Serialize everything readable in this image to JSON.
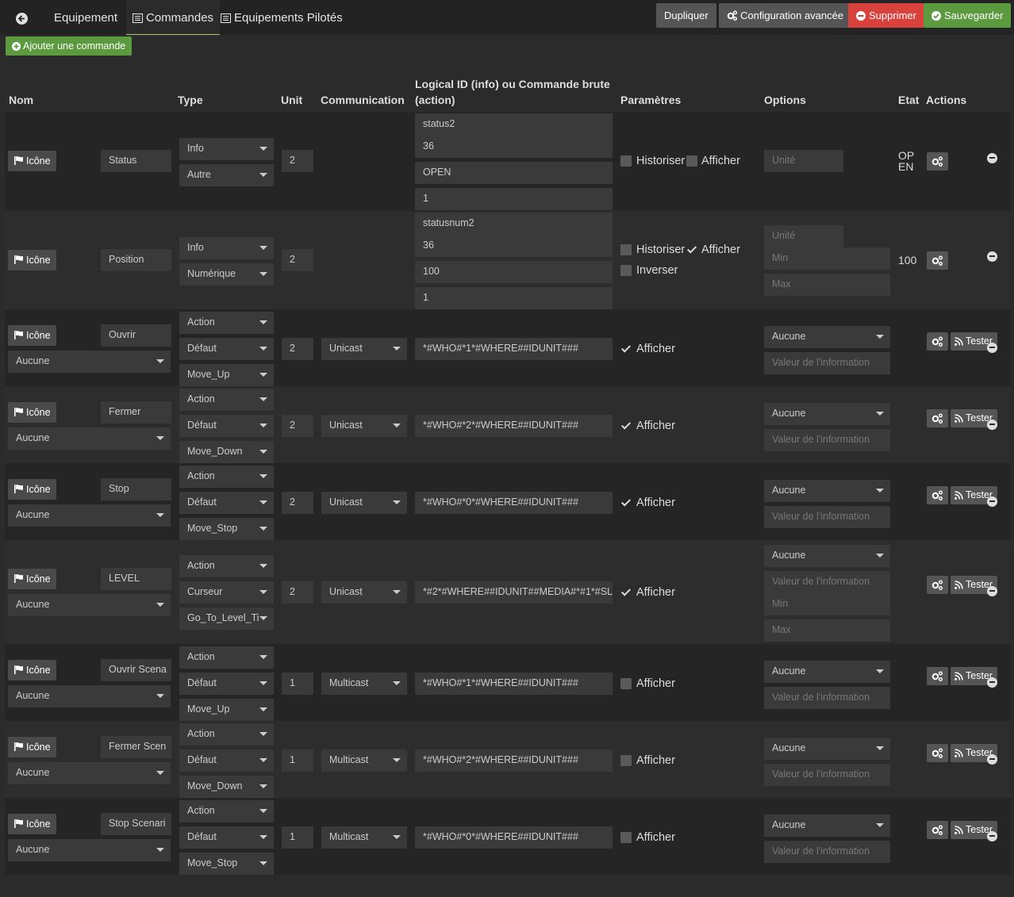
{
  "tabs": {
    "equipement": "Equipement",
    "commandes": "Commandes",
    "pilotes": "Equipements Pilotés"
  },
  "toolbar": {
    "dupliquer": "Dupliquer",
    "config": "Configuration avancée",
    "supprimer": "Supprimer",
    "sauvegarder": "Sauvegarder"
  },
  "add_command": "Ajouter une commande",
  "headers": {
    "nom": "Nom",
    "type": "Type",
    "unit": "Unit",
    "communication": "Communication",
    "logical_l1": "Logical ID (info) ou Commande brute",
    "logical_l2": "(action)",
    "parametres": "Paramètres",
    "options": "Options",
    "etat": "Etat",
    "actions": "Actions"
  },
  "labels": {
    "icone": "Icône",
    "historiser": "Historiser",
    "afficher": "Afficher",
    "inverser": "Inverser",
    "tester": "Tester"
  },
  "info_rows": [
    {
      "name": "Status",
      "type": "Info",
      "subtype": "Autre",
      "unit": "2",
      "logical": [
        "status2",
        "36",
        "OPEN",
        "1"
      ],
      "historiser": false,
      "afficher": false,
      "options": [
        "Unité"
      ],
      "state": [
        "OP",
        "EN"
      ]
    },
    {
      "name": "Position",
      "type": "Info",
      "subtype": "Numérique",
      "unit": "2",
      "logical": [
        "statusnum2",
        "36",
        "100",
        "1"
      ],
      "historiser": false,
      "afficher": true,
      "inverser": false,
      "options": [
        "Unité",
        "Min",
        "Max"
      ],
      "state": [
        "100"
      ]
    }
  ],
  "action_rows": [
    {
      "name": "Ouvrir",
      "link": "Aucune",
      "type": "Action",
      "subtype": "Défaut",
      "cmd": "Move_Up",
      "unit": "2",
      "comm": "Unicast",
      "raw": "*#WHO#*1*#WHERE##IDUNIT###",
      "afficher": true,
      "opt_select": "Aucune",
      "opt_value": "Valeur de l'information"
    },
    {
      "name": "Fermer",
      "link": "Aucune",
      "type": "Action",
      "subtype": "Défaut",
      "cmd": "Move_Down",
      "unit": "2",
      "comm": "Unicast",
      "raw": "*#WHO#*2*#WHERE##IDUNIT###",
      "afficher": true,
      "opt_select": "Aucune",
      "opt_value": "Valeur de l'information"
    },
    {
      "name": "Stop",
      "link": "Aucune",
      "type": "Action",
      "subtype": "Défaut",
      "cmd": "Move_Stop",
      "unit": "2",
      "comm": "Unicast",
      "raw": "*#WHO#*0*#WHERE##IDUNIT###",
      "afficher": true,
      "opt_select": "Aucune",
      "opt_value": "Valeur de l'information"
    },
    {
      "name": "LEVEL",
      "link": "Aucune",
      "type": "Action",
      "subtype": "Curseur",
      "cmd": "Go_To_Level_Ti",
      "unit": "2",
      "comm": "Unicast",
      "raw": "*#2*#WHERE##IDUNIT##MEDIA#*#1*#SL",
      "afficher": true,
      "opt_select": "Aucune",
      "opt_value": "Valeur de l'information",
      "opt_min": "Min",
      "opt_max": "Max"
    },
    {
      "name": "Ouvrir Scena",
      "link": "Aucune",
      "type": "Action",
      "subtype": "Défaut",
      "cmd": "Move_Up",
      "unit": "1",
      "comm": "Multicast",
      "raw": "*#WHO#*1*#WHERE##IDUNIT###",
      "afficher": false,
      "opt_select": "Aucune",
      "opt_value": "Valeur de l'information"
    },
    {
      "name": "Fermer Scen",
      "link": "Aucune",
      "type": "Action",
      "subtype": "Défaut",
      "cmd": "Move_Down",
      "unit": "1",
      "comm": "Multicast",
      "raw": "*#WHO#*2*#WHERE##IDUNIT###",
      "afficher": false,
      "opt_select": "Aucune",
      "opt_value": "Valeur de l'information"
    },
    {
      "name": "Stop Scenari",
      "link": "Aucune",
      "type": "Action",
      "subtype": "Défaut",
      "cmd": "Move_Stop",
      "unit": "1",
      "comm": "Multicast",
      "raw": "*#WHO#*0*#WHERE##IDUNIT###",
      "afficher": false,
      "opt_select": "Aucune",
      "opt_value": "Valeur de l'information"
    }
  ]
}
